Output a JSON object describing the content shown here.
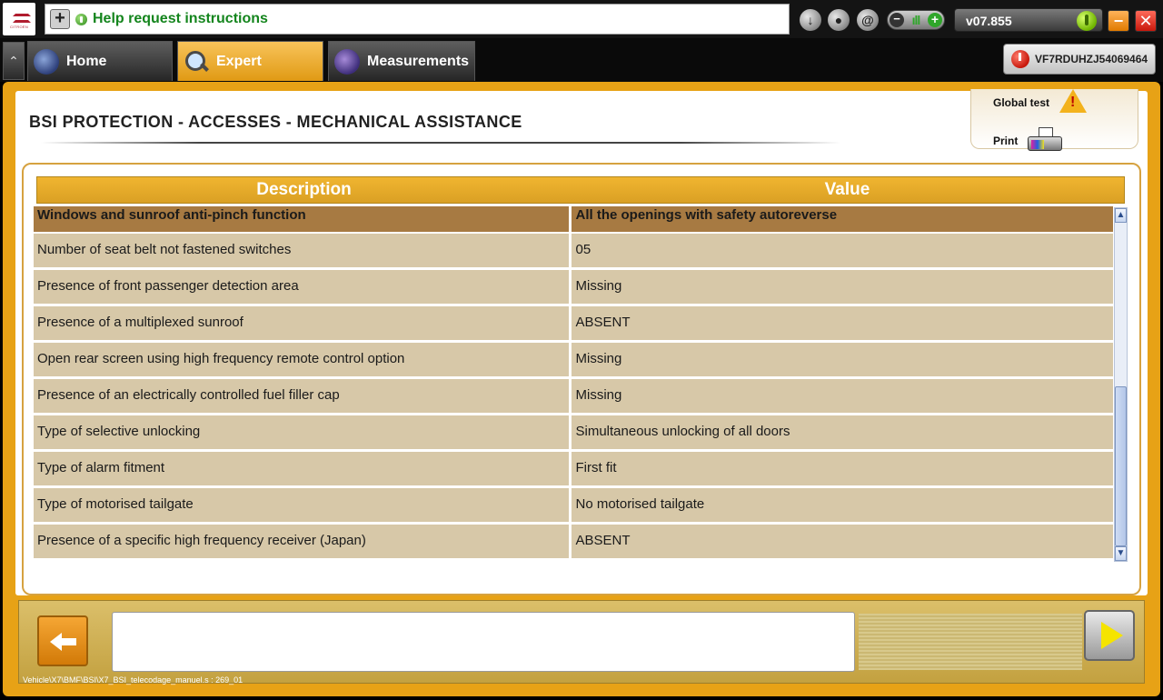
{
  "topbar": {
    "logo_brand": "CITROËN",
    "help_text": "Help request instructions",
    "version": "v07.855",
    "icons": [
      "download-icon",
      "profile-icon",
      "at-icon",
      "volume-toggle",
      "power-icon"
    ]
  },
  "tabs": [
    {
      "label": "Home",
      "active": false
    },
    {
      "label": "Expert",
      "active": true
    },
    {
      "label": "Measurements",
      "active": false
    }
  ],
  "vin": "VF7RDUHZJ54069464",
  "page": {
    "title": "BSI  PROTECTION - ACCESSES - MECHANICAL ASSISTANCE"
  },
  "side_panel": {
    "global_test": "Global test",
    "print": "Print"
  },
  "table": {
    "headers": {
      "description": "Description",
      "value": "Value"
    },
    "rows": [
      {
        "description": "Windows and sunroof anti-pinch function",
        "value": "All the openings with safety autoreverse"
      },
      {
        "description": "Number of seat belt not fastened switches",
        "value": "05"
      },
      {
        "description": "Presence of front passenger detection area",
        "value": "Missing"
      },
      {
        "description": "Presence of a multiplexed sunroof",
        "value": "ABSENT"
      },
      {
        "description": "Open rear screen using high frequency remote control option",
        "value": "Missing"
      },
      {
        "description": "Presence of an electrically controlled fuel filler cap",
        "value": "Missing"
      },
      {
        "description": "Type of selective unlocking",
        "value": "Simultaneous unlocking of all doors"
      },
      {
        "description": "Type of alarm fitment",
        "value": "First fit"
      },
      {
        "description": "Type of motorised tailgate",
        "value": "No motorised tailgate"
      },
      {
        "description": "Presence of a specific high frequency receiver (Japan)",
        "value": "ABSENT"
      }
    ]
  },
  "footer": {
    "path": "Vehicle\\X7\\BMF\\BSI\\X7_BSI_telecodage_manuel.s : 269_01",
    "message": ""
  },
  "colors": {
    "accent": "#e7a216",
    "row_bg": "#d7c8a8",
    "row_highlight": "#a77a42",
    "help_text": "#14851d"
  }
}
